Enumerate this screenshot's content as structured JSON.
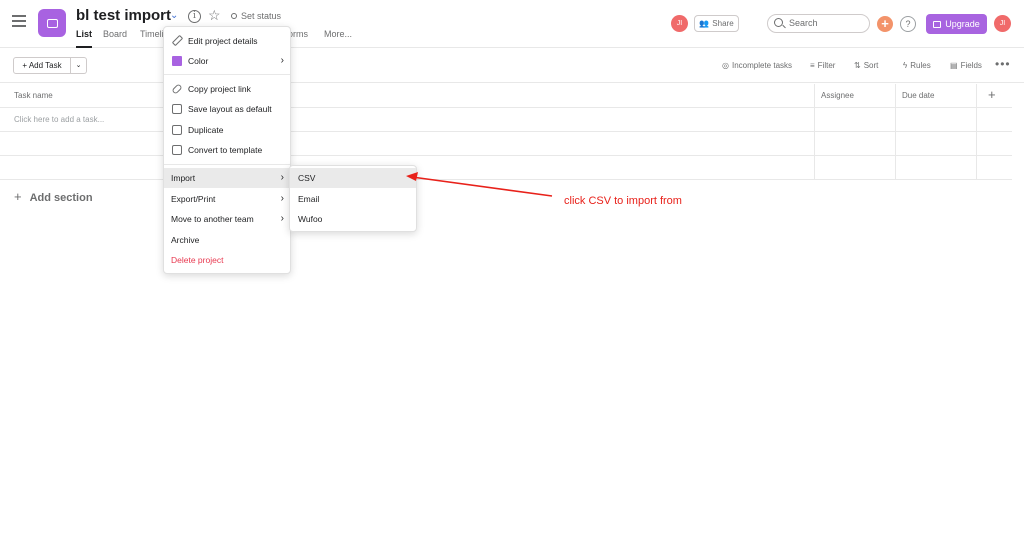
{
  "header": {
    "project_title": "bl test import",
    "set_status": "Set status",
    "tabs": [
      {
        "label": "List",
        "active": true
      },
      {
        "label": "Board",
        "active": false
      },
      {
        "label": "Timeli",
        "active": false
      },
      {
        "label": "orms",
        "active": false
      },
      {
        "label": "More...",
        "active": false
      }
    ],
    "avatar_initials": "JI",
    "share_label": "Share",
    "search_placeholder": "Search",
    "plus_label": "+",
    "help_label": "?",
    "upgrade_label": "Upgrade",
    "project_color": "#a862e1",
    "upgrade_color": "#a864e0"
  },
  "toolbar": {
    "add_task_label": "+ Add Task",
    "dropdown_caret": "⌄",
    "incomplete_tasks": "Incomplete tasks",
    "filter": "Filter",
    "sort": "Sort",
    "rules": "Rules",
    "fields": "Fields",
    "more": "•••"
  },
  "table": {
    "columns": [
      "Task name",
      "Assignee",
      "Due date"
    ],
    "add_column": "+",
    "add_task_placeholder": "Click here to add a task...",
    "add_section": "Add section"
  },
  "menu": {
    "items": [
      {
        "label": "Edit project details",
        "icon": "pencil-icon"
      },
      {
        "label": "Color",
        "icon": "color-swatch-icon",
        "submenu": true
      },
      {
        "label": "Copy project link",
        "icon": "link-icon"
      },
      {
        "label": "Save layout as default",
        "icon": "layout-icon"
      },
      {
        "label": "Duplicate",
        "icon": "duplicate-icon"
      },
      {
        "label": "Convert to template",
        "icon": "template-icon"
      },
      {
        "label": "Import",
        "submenu": true,
        "highlight": true
      },
      {
        "label": "Export/Print",
        "submenu": true
      },
      {
        "label": "Move to another team",
        "submenu": true
      },
      {
        "label": "Archive"
      },
      {
        "label": "Delete project",
        "danger": true
      }
    ]
  },
  "submenu": {
    "items": [
      {
        "label": "CSV",
        "highlight": true
      },
      {
        "label": "Email"
      },
      {
        "label": "Wufoo"
      }
    ]
  },
  "annotation": {
    "text": "click CSV to import from",
    "color": "#e8211a"
  }
}
